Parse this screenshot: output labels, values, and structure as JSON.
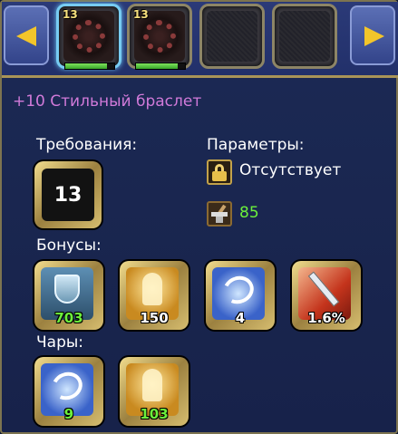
{
  "tabs": {
    "slots": [
      {
        "level": "13",
        "state": "selected",
        "hp": 0.85
      },
      {
        "level": "13",
        "state": "normal",
        "hp": 0.85
      },
      {
        "level": "",
        "state": "empty"
      },
      {
        "level": "",
        "state": "empty"
      }
    ]
  },
  "item": {
    "title": "+10 Стильный браслет"
  },
  "requirements": {
    "label": "Требования:",
    "level": "13"
  },
  "params": {
    "label": "Параметры:",
    "status": "Отсутствует",
    "durability": "85"
  },
  "bonuses": {
    "label": "Бонусы:",
    "items": [
      {
        "icon": "shield-icon",
        "value": "703",
        "color": "green"
      },
      {
        "icon": "strength-icon",
        "value": "150",
        "color": "white"
      },
      {
        "icon": "swirl-icon",
        "value": "4",
        "color": "white"
      },
      {
        "icon": "sword-icon",
        "value": "1.6%",
        "color": "white"
      }
    ]
  },
  "enchant": {
    "label": "Чары:",
    "items": [
      {
        "icon": "swirl-icon",
        "value": "9",
        "color": "green"
      },
      {
        "icon": "strength-icon",
        "value": "103",
        "color": "green"
      }
    ]
  },
  "colors": {
    "title": "#d17ad9",
    "green": "#6cf03c",
    "gold_frame": "#c7ad62"
  }
}
